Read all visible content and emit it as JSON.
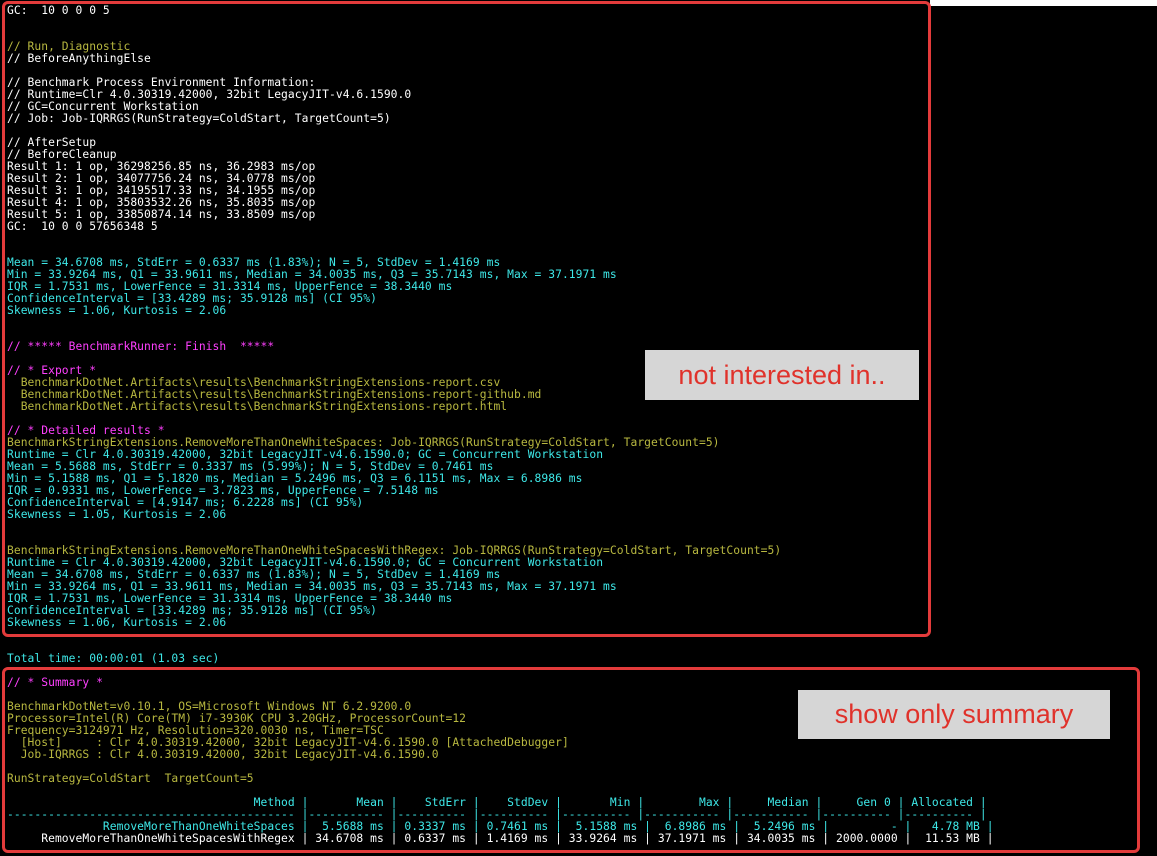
{
  "console_lines": [
    {
      "text": "GC:  10 0 0 0 5",
      "color": "w"
    },
    {
      "text": "",
      "color": "w"
    },
    {
      "text": "",
      "color": "w"
    },
    {
      "text": "// Run, Diagnostic",
      "color": "y"
    },
    {
      "text": "// BeforeAnythingElse",
      "color": "w"
    },
    {
      "text": "",
      "color": "w"
    },
    {
      "text": "// Benchmark Process Environment Information:",
      "color": "w"
    },
    {
      "text": "// Runtime=Clr 4.0.30319.42000, 32bit LegacyJIT-v4.6.1590.0",
      "color": "w"
    },
    {
      "text": "// GC=Concurrent Workstation",
      "color": "w"
    },
    {
      "text": "// Job: Job-IQRRGS(RunStrategy=ColdStart, TargetCount=5)",
      "color": "w"
    },
    {
      "text": "",
      "color": "w"
    },
    {
      "text": "// AfterSetup",
      "color": "w"
    },
    {
      "text": "// BeforeCleanup",
      "color": "w"
    },
    {
      "text": "Result 1: 1 op, 36298256.85 ns, 36.2983 ms/op",
      "color": "w"
    },
    {
      "text": "Result 2: 1 op, 34077756.24 ns, 34.0778 ms/op",
      "color": "w"
    },
    {
      "text": "Result 3: 1 op, 34195517.33 ns, 34.1955 ms/op",
      "color": "w"
    },
    {
      "text": "Result 4: 1 op, 35803532.26 ns, 35.8035 ms/op",
      "color": "w"
    },
    {
      "text": "Result 5: 1 op, 33850874.14 ns, 33.8509 ms/op",
      "color": "w"
    },
    {
      "text": "GC:  10 0 0 57656348 5",
      "color": "w"
    },
    {
      "text": "",
      "color": "w"
    },
    {
      "text": "",
      "color": "w"
    },
    {
      "text": "Mean = 34.6708 ms, StdErr = 0.6337 ms (1.83%); N = 5, StdDev = 1.4169 ms",
      "color": "c"
    },
    {
      "text": "Min = 33.9264 ms, Q1 = 33.9611 ms, Median = 34.0035 ms, Q3 = 35.7143 ms, Max = 37.1971 ms",
      "color": "c"
    },
    {
      "text": "IQR = 1.7531 ms, LowerFence = 31.3314 ms, UpperFence = 38.3440 ms",
      "color": "c"
    },
    {
      "text": "ConfidenceInterval = [33.4289 ms; 35.9128 ms] (CI 95%)",
      "color": "c"
    },
    {
      "text": "Skewness = 1.06, Kurtosis = 2.06",
      "color": "c"
    },
    {
      "text": "",
      "color": "w"
    },
    {
      "text": "",
      "color": "w"
    },
    {
      "text": "// ***** BenchmarkRunner: Finish  *****",
      "color": "m"
    },
    {
      "text": "",
      "color": "w"
    },
    {
      "text": "// * Export *",
      "color": "m"
    },
    {
      "text": "  BenchmarkDotNet.Artifacts\\results\\BenchmarkStringExtensions-report.csv",
      "color": "y"
    },
    {
      "text": "  BenchmarkDotNet.Artifacts\\results\\BenchmarkStringExtensions-report-github.md",
      "color": "y"
    },
    {
      "text": "  BenchmarkDotNet.Artifacts\\results\\BenchmarkStringExtensions-report.html",
      "color": "y"
    },
    {
      "text": "",
      "color": "w"
    },
    {
      "text": "// * Detailed results *",
      "color": "m"
    },
    {
      "text": "BenchmarkStringExtensions.RemoveMoreThanOneWhiteSpaces: Job-IQRRGS(RunStrategy=ColdStart, TargetCount=5)",
      "color": "y"
    },
    {
      "text": "Runtime = Clr 4.0.30319.42000, 32bit LegacyJIT-v4.6.1590.0; GC = Concurrent Workstation",
      "color": "c"
    },
    {
      "text": "Mean = 5.5688 ms, StdErr = 0.3337 ms (5.99%); N = 5, StdDev = 0.7461 ms",
      "color": "c"
    },
    {
      "text": "Min = 5.1588 ms, Q1 = 5.1820 ms, Median = 5.2496 ms, Q3 = 6.1151 ms, Max = 6.8986 ms",
      "color": "c"
    },
    {
      "text": "IQR = 0.9331 ms, LowerFence = 3.7823 ms, UpperFence = 7.5148 ms",
      "color": "c"
    },
    {
      "text": "ConfidenceInterval = [4.9147 ms; 6.2228 ms] (CI 95%)",
      "color": "c"
    },
    {
      "text": "Skewness = 1.05, Kurtosis = 2.06",
      "color": "c"
    },
    {
      "text": "",
      "color": "w"
    },
    {
      "text": "",
      "color": "w"
    },
    {
      "text": "BenchmarkStringExtensions.RemoveMoreThanOneWhiteSpacesWithRegex: Job-IQRRGS(RunStrategy=ColdStart, TargetCount=5)",
      "color": "y"
    },
    {
      "text": "Runtime = Clr 4.0.30319.42000, 32bit LegacyJIT-v4.6.1590.0; GC = Concurrent Workstation",
      "color": "c"
    },
    {
      "text": "Mean = 34.6708 ms, StdErr = 0.6337 ms (1.83%); N = 5, StdDev = 1.4169 ms",
      "color": "c"
    },
    {
      "text": "Min = 33.9264 ms, Q1 = 33.9611 ms, Median = 34.0035 ms, Q3 = 35.7143 ms, Max = 37.1971 ms",
      "color": "c"
    },
    {
      "text": "IQR = 1.7531 ms, LowerFence = 31.3314 ms, UpperFence = 38.3440 ms",
      "color": "c"
    },
    {
      "text": "ConfidenceInterval = [33.4289 ms; 35.9128 ms] (CI 95%)",
      "color": "c"
    },
    {
      "text": "Skewness = 1.06, Kurtosis = 2.06",
      "color": "c"
    },
    {
      "text": "",
      "color": "w"
    },
    {
      "text": "",
      "color": "w"
    },
    {
      "text": "Total time: 00:00:01 (1.03 sec)",
      "color": "c"
    },
    {
      "text": "",
      "color": "w"
    },
    {
      "text": "// * Summary *",
      "color": "m"
    },
    {
      "text": "",
      "color": "w"
    },
    {
      "text": "BenchmarkDotNet=v0.10.1, OS=Microsoft Windows NT 6.2.9200.0",
      "color": "y"
    },
    {
      "text": "Processor=Intel(R) Core(TM) i7-3930K CPU 3.20GHz, ProcessorCount=12",
      "color": "y"
    },
    {
      "text": "Frequency=3124971 Hz, Resolution=320.0030 ns, Timer=TSC",
      "color": "y"
    },
    {
      "text": "  [Host]     : Clr 4.0.30319.42000, 32bit LegacyJIT-v4.6.1590.0 [AttachedDebugger]",
      "color": "y"
    },
    {
      "text": "  Job-IQRRGS : Clr 4.0.30319.42000, 32bit LegacyJIT-v4.6.1590.0",
      "color": "y"
    },
    {
      "text": "",
      "color": "w"
    },
    {
      "text": "RunStrategy=ColdStart  TargetCount=5",
      "color": "y"
    },
    {
      "text": "",
      "color": "w"
    },
    {
      "text": "                                    Method |       Mean |    StdErr |    StdDev |       Min |        Max |     Median |     Gen 0 | Allocated |",
      "color": "c"
    },
    {
      "text": "------------------------------------------ |----------- |---------- |---------- |---------- |----------- |----------- |---------- |---------- |",
      "color": "c"
    },
    {
      "text": "              RemoveMoreThanOneWhiteSpaces |  5.5688 ms | 0.3337 ms | 0.7461 ms |  5.1588 ms |  6.8986 ms |  5.2496 ms |         - |   4.78 MB |",
      "color": "c"
    },
    {
      "text": "     RemoveMoreThanOneWhiteSpacesWithRegex | 34.6708 ms | 0.6337 ms | 1.4169 ms | 33.9264 ms | 37.1971 ms | 34.0035 ms | 2000.0000 |  11.53 MB |",
      "color": "w"
    }
  ],
  "callouts": {
    "top": "not interested in..",
    "bottom": "show only summary"
  },
  "colors": {
    "frame": "#e33b3b",
    "callout_bg": "#d6d6d6",
    "callout_text": "#e0322b"
  }
}
